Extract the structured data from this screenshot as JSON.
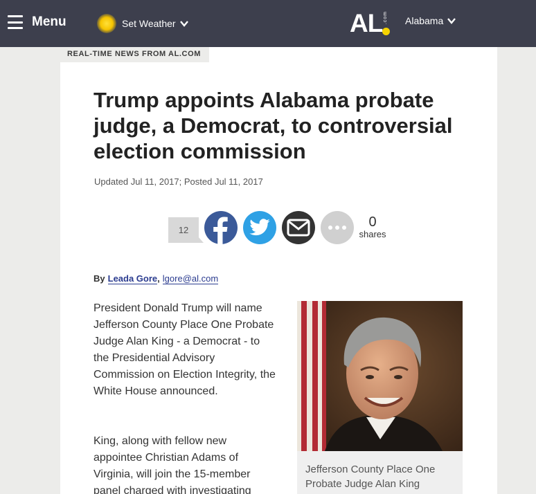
{
  "header": {
    "menu_label": "Menu",
    "weather_label": "Set Weather",
    "logo_text": "AL",
    "logo_com": ".com",
    "region_label": "Alabama"
  },
  "article": {
    "kicker": "REAL-TIME NEWS FROM AL.COM",
    "headline": "Trump appoints Alabama probate judge, a Democrat, to controversial election commission",
    "dateline": "Updated Jul 11, 2017; Posted Jul 11, 2017",
    "share": {
      "comment_count": "12",
      "share_count": "0",
      "share_label": "shares"
    },
    "byline": {
      "by": "By",
      "author": "Leada Gore",
      "separator": ",",
      "email": "lgore@al.com"
    },
    "paragraphs": [
      "President Donald Trump will name Jefferson County Place One Probate Judge Alan King  - a Democrat - to the Presidential Advisory Commission on Election Integrity, the White House announced.",
      "King, along with fellow new appointee Christian Adams of Virginia, will join the 15-member panel charged with investigating"
    ],
    "photo_caption": "Jefferson County Place One Probate Judge Alan King"
  },
  "colors": {
    "topbar": "#3d3f4d",
    "facebook": "#3b5a99",
    "twitter": "#2fa1e5",
    "email": "#333333",
    "more": "#d0d0d0",
    "link": "#2a3b8f",
    "logo_dot": "#f5d300"
  }
}
